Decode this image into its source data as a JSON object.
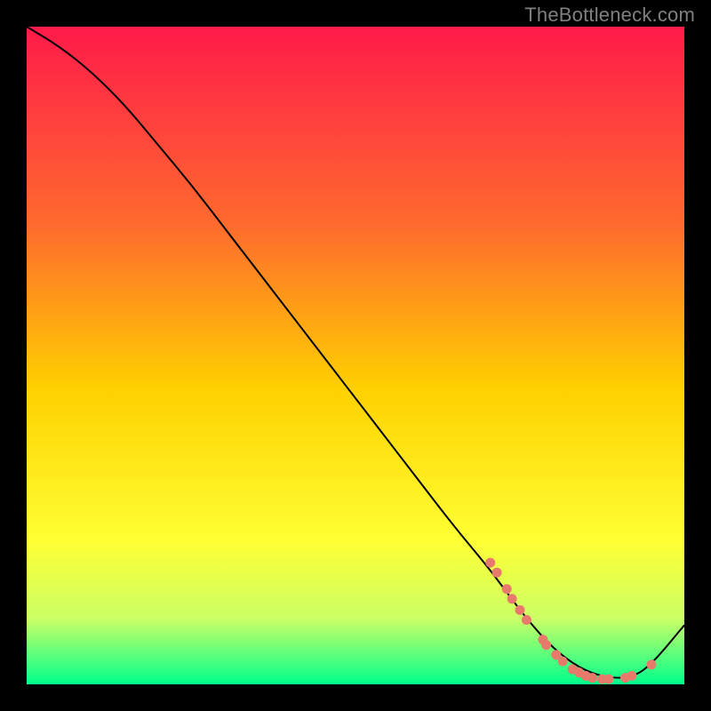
{
  "watermark": "TheBottleneck.com",
  "colors": {
    "bg": "#000000",
    "gradient_top": "#ff1a4a",
    "gradient_mid1": "#ff6a2e",
    "gradient_mid2": "#ffd000",
    "gradient_mid3": "#ffff33",
    "gradient_mid4": "#ccff66",
    "gradient_bot": "#00ff8c",
    "curve": "#000000",
    "dots": "#e77a6b"
  },
  "chart_data": {
    "type": "line",
    "title": "",
    "xlabel": "",
    "ylabel": "",
    "xlim": [
      0,
      100
    ],
    "ylim": [
      0,
      100
    ],
    "series": [
      {
        "name": "bottleneck-curve",
        "x": [
          0,
          5,
          10,
          15,
          20,
          25,
          30,
          35,
          40,
          45,
          50,
          55,
          60,
          65,
          70,
          73,
          76,
          80,
          84,
          88,
          92,
          95,
          100
        ],
        "values": [
          100,
          97,
          93,
          88,
          82,
          76,
          69.5,
          63,
          56.5,
          50,
          43.5,
          37,
          30.5,
          24,
          18,
          14,
          10,
          5.5,
          2.5,
          1,
          1,
          3,
          9
        ]
      }
    ],
    "dots": [
      {
        "x": 70.5,
        "y": 18.5
      },
      {
        "x": 71.5,
        "y": 17.0
      },
      {
        "x": 73.0,
        "y": 14.5
      },
      {
        "x": 73.8,
        "y": 13.0
      },
      {
        "x": 75.0,
        "y": 11.3
      },
      {
        "x": 76.0,
        "y": 9.8
      },
      {
        "x": 78.5,
        "y": 6.8
      },
      {
        "x": 79.0,
        "y": 6.0
      },
      {
        "x": 80.5,
        "y": 4.5
      },
      {
        "x": 81.5,
        "y": 3.5
      },
      {
        "x": 83.0,
        "y": 2.3
      },
      {
        "x": 84.0,
        "y": 1.8
      },
      {
        "x": 85.0,
        "y": 1.3
      },
      {
        "x": 86.0,
        "y": 1.0
      },
      {
        "x": 87.5,
        "y": 0.8
      },
      {
        "x": 88.5,
        "y": 0.8
      },
      {
        "x": 91.0,
        "y": 1.0
      },
      {
        "x": 92.0,
        "y": 1.3
      },
      {
        "x": 95.0,
        "y": 3.0
      }
    ]
  }
}
